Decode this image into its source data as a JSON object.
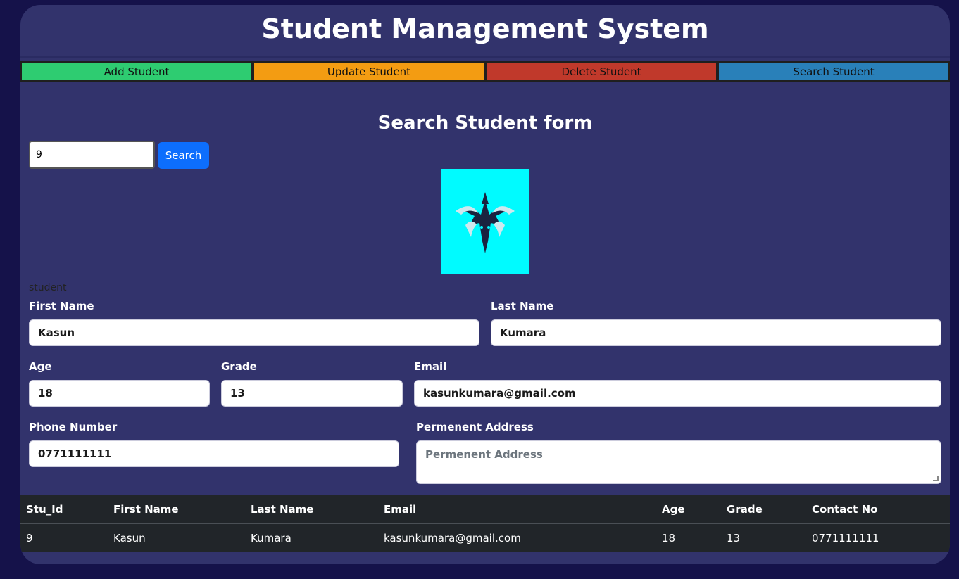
{
  "header": {
    "title": "Student Management System"
  },
  "nav": {
    "add": "Add Student",
    "update": "Update Student",
    "delete": "Delete Student",
    "search": "Search Student"
  },
  "search_form": {
    "title": "Search Student form",
    "input_value": "9",
    "button_label": "Search",
    "photo_alt": "student",
    "photo_icon": "dragon-logo"
  },
  "fields": {
    "first_name": {
      "label": "First Name",
      "value": "Kasun"
    },
    "last_name": {
      "label": "Last Name",
      "value": "Kumara"
    },
    "age": {
      "label": "Age",
      "value": "18"
    },
    "grade": {
      "label": "Grade",
      "value": "13"
    },
    "email": {
      "label": "Email",
      "value": "kasunkumara@gmail.com"
    },
    "phone": {
      "label": "Phone Number",
      "value": "0771111111"
    },
    "address": {
      "label": "Permenent Address",
      "placeholder": "Permenent Address"
    }
  },
  "table": {
    "headers": [
      "Stu_Id",
      "First Name",
      "Last Name",
      "Email",
      "Age",
      "Grade",
      "Contact No"
    ],
    "rows": [
      [
        "9",
        "Kasun",
        "Kumara",
        "kasunkumara@gmail.com",
        "18",
        "13",
        "0771111111"
      ]
    ]
  },
  "colors": {
    "page_bg": "#15124a",
    "card_bg": "#32336c",
    "add": "#2ecc71",
    "update": "#f39c12",
    "delete": "#c0392b",
    "search": "#2980b9",
    "primary": "#0d6efd",
    "photo_bg": "#00fbff"
  }
}
